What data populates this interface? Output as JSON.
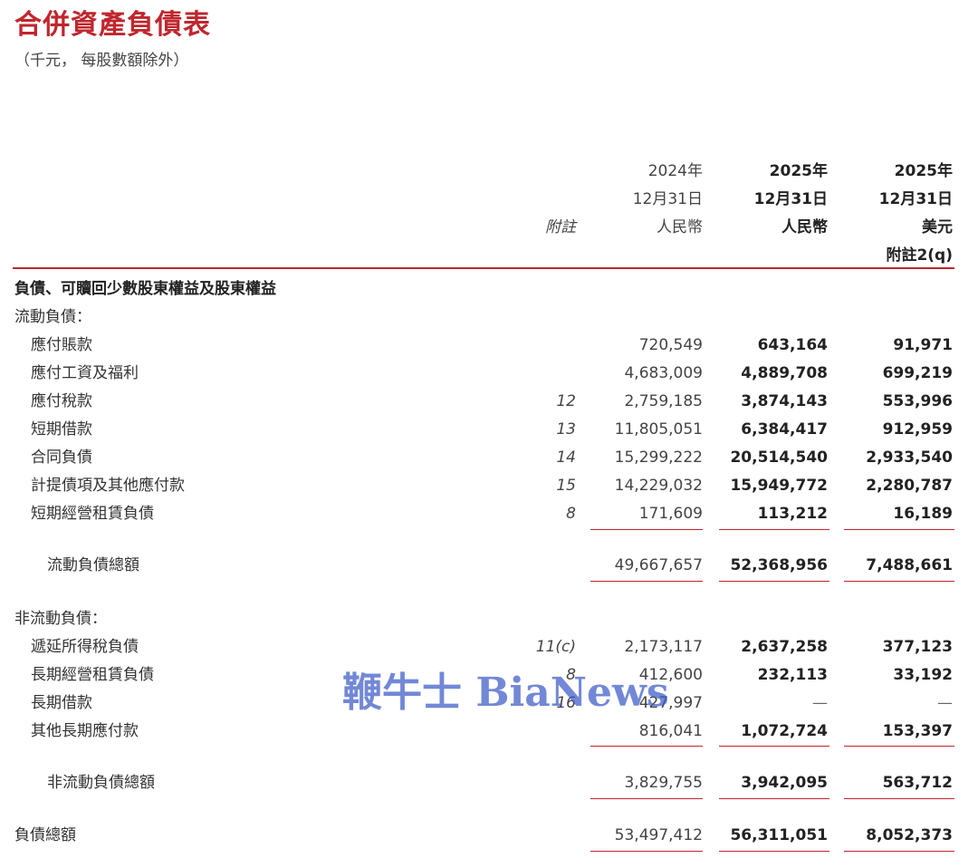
{
  "title": "合併資產負債表",
  "subtitle": "（千元， 每股數額除外）",
  "header": {
    "note_label": "附註",
    "col1": {
      "year": "2024年",
      "date": "12月31日",
      "currency": "人民幣"
    },
    "col2": {
      "year": "2025年",
      "date": "12月31日",
      "currency": "人民幣"
    },
    "col3": {
      "year": "2025年",
      "date": "12月31日",
      "currency": "美元",
      "note": "附註2(q)"
    }
  },
  "section_title": "負債、可贖回少數股東權益及股東權益",
  "current": {
    "heading": "流動負債：",
    "rows": [
      {
        "label": "應付賬款",
        "note": "",
        "v2024": "720,549",
        "v2025": "643,164",
        "usd": "91,971"
      },
      {
        "label": "應付工資及福利",
        "note": "",
        "v2024": "4,683,009",
        "v2025": "4,889,708",
        "usd": "699,219"
      },
      {
        "label": "應付稅款",
        "note": "12",
        "v2024": "2,759,185",
        "v2025": "3,874,143",
        "usd": "553,996"
      },
      {
        "label": "短期借款",
        "note": "13",
        "v2024": "11,805,051",
        "v2025": "6,384,417",
        "usd": "912,959"
      },
      {
        "label": "合同負債",
        "note": "14",
        "v2024": "15,299,222",
        "v2025": "20,514,540",
        "usd": "2,933,540"
      },
      {
        "label": "計提債項及其他應付款",
        "note": "15",
        "v2024": "14,229,032",
        "v2025": "15,949,772",
        "usd": "2,280,787"
      },
      {
        "label": "短期經營租賃負債",
        "note": "8",
        "v2024": "171,609",
        "v2025": "113,212",
        "usd": "16,189"
      }
    ],
    "total": {
      "label": "流動負債總額",
      "v2024": "49,667,657",
      "v2025": "52,368,956",
      "usd": "7,488,661"
    }
  },
  "noncurrent": {
    "heading": "非流動負債：",
    "rows": [
      {
        "label": "遞延所得稅負債",
        "note": "11(c)",
        "v2024": "2,173,117",
        "v2025": "2,637,258",
        "usd": "377,123"
      },
      {
        "label": "長期經營租賃負債",
        "note": "8",
        "v2024": "412,600",
        "v2025": "232,113",
        "usd": "33,192"
      },
      {
        "label": "長期借款",
        "note": "16",
        "v2024": "427,997",
        "v2025": "—",
        "usd": "—"
      },
      {
        "label": "其他長期應付款",
        "note": "",
        "v2024": "816,041",
        "v2025": "1,072,724",
        "usd": "153,397"
      }
    ],
    "total": {
      "label": "非流動負債總額",
      "v2024": "3,829,755",
      "v2025": "3,942,095",
      "usd": "563,712"
    }
  },
  "grand_total": {
    "label": "負債總額",
    "v2024": "53,497,412",
    "v2025": "56,311,051",
    "usd": "8,052,373"
  },
  "watermark": "鞭牛士 BiaNews",
  "colors": {
    "accent": "#c0262d",
    "watermark": "#3c5ac8"
  }
}
